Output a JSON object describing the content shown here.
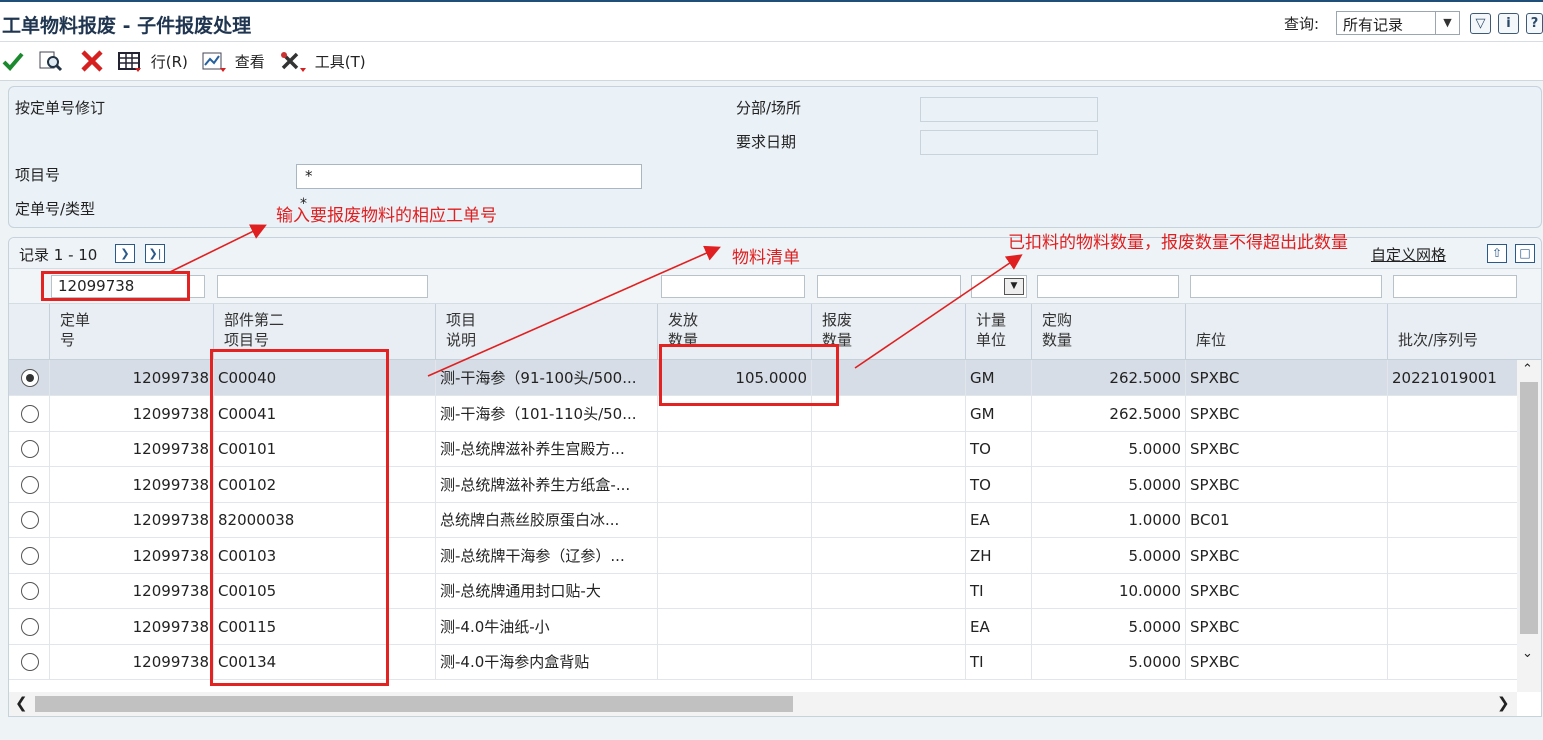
{
  "window": {
    "title": "工单物料报废 - 子件报废处理",
    "query_label": "查询:",
    "query_value": "所有记录"
  },
  "toolbar": {
    "row_label": "行(R)",
    "view_label": "查看",
    "tools_label": "工具(T)"
  },
  "header": {
    "revise_label": "按定单号修订",
    "branch_label": "分部/场所",
    "branch_value": "",
    "reqdate_label": "要求日期",
    "reqdate_value": "",
    "item_label": "项目号",
    "item_value": "*",
    "order_label": "定单号/类型",
    "order_value": "*"
  },
  "grid": {
    "records_label": "记录 1 - 10",
    "customize_label": "自定义网格",
    "filter_order": "12099738",
    "columns": {
      "order": [
        "定单",
        "号"
      ],
      "part": [
        "部件第二",
        "项目号"
      ],
      "desc": [
        "项目",
        "说明"
      ],
      "issued": [
        "发放",
        "数量"
      ],
      "scrap": [
        "报废",
        "数量"
      ],
      "uom": [
        "计量",
        "单位"
      ],
      "ordqty": [
        "定购",
        "数量"
      ],
      "loc": [
        "",
        "库位"
      ],
      "lot": [
        "",
        "批次/序列号"
      ]
    },
    "rows": [
      {
        "order": "12099738",
        "part": "C00040",
        "desc": "测-干海参（91-100头/500...",
        "issued": "105.0000",
        "scrap": "",
        "uom": "GM",
        "ordqty": "262.5000",
        "loc": "SPXBC",
        "lot": "20221019001"
      },
      {
        "order": "12099738",
        "part": "C00041",
        "desc": "测-干海参（101-110头/50...",
        "issued": "",
        "scrap": "",
        "uom": "GM",
        "ordqty": "262.5000",
        "loc": "SPXBC",
        "lot": ""
      },
      {
        "order": "12099738",
        "part": "C00101",
        "desc": "测-总统牌滋补养生宫殿方...",
        "issued": "",
        "scrap": "",
        "uom": "TO",
        "ordqty": "5.0000",
        "loc": "SPXBC",
        "lot": ""
      },
      {
        "order": "12099738",
        "part": "C00102",
        "desc": "测-总统牌滋补养生方纸盒-...",
        "issued": "",
        "scrap": "",
        "uom": "TO",
        "ordqty": "5.0000",
        "loc": "SPXBC",
        "lot": ""
      },
      {
        "order": "12099738",
        "part": "82000038",
        "desc": "总统牌白燕丝胶原蛋白冰...",
        "issued": "",
        "scrap": "",
        "uom": "EA",
        "ordqty": "1.0000",
        "loc": "BC01",
        "lot": ""
      },
      {
        "order": "12099738",
        "part": "C00103",
        "desc": "测-总统牌干海参（辽参）...",
        "issued": "",
        "scrap": "",
        "uom": "ZH",
        "ordqty": "5.0000",
        "loc": "SPXBC",
        "lot": ""
      },
      {
        "order": "12099738",
        "part": "C00105",
        "desc": "测-总统牌通用封口贴-大",
        "issued": "",
        "scrap": "",
        "uom": "TI",
        "ordqty": "10.0000",
        "loc": "SPXBC",
        "lot": ""
      },
      {
        "order": "12099738",
        "part": "C00115",
        "desc": "测-4.0牛油纸-小",
        "issued": "",
        "scrap": "",
        "uom": "EA",
        "ordqty": "5.0000",
        "loc": "SPXBC",
        "lot": ""
      },
      {
        "order": "12099738",
        "part": "C00134",
        "desc": "测-4.0干海参内盒背贴",
        "issued": "",
        "scrap": "",
        "uom": "TI",
        "ordqty": "5.0000",
        "loc": "SPXBC",
        "lot": ""
      }
    ]
  },
  "annotations": {
    "order_hint": "输入要报废物料的相应工单号",
    "bom_hint": "物料清单",
    "qty_hint": "已扣料的物料数量，报废数量不得超出此数量"
  },
  "colors": {
    "accent": "#1f4e79",
    "annotation": "#e02020",
    "selected_row": "#d6dde6"
  }
}
